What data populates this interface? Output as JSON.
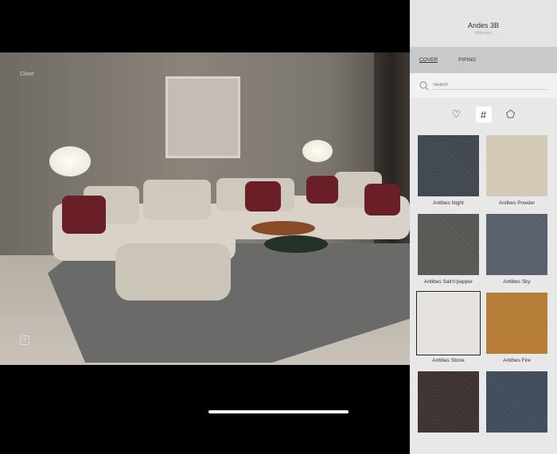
{
  "viewer": {
    "close_label": "Close"
  },
  "panel": {
    "title": "Andes 3B",
    "brand": "Wittmann",
    "tabs": [
      {
        "label": "COVER",
        "active": true
      },
      {
        "label": "PIPING",
        "active": false
      }
    ],
    "search_placeholder": "Search",
    "filters": [
      {
        "icon": "heart-icon"
      },
      {
        "icon": "fabric-icon",
        "active": true
      },
      {
        "icon": "leather-icon"
      }
    ],
    "swatches": [
      {
        "name": "Antibes Night",
        "color": "#3f454c"
      },
      {
        "name": "Antibes Powder",
        "color": "#d3c9b6"
      },
      {
        "name": "Antibes Salt'n'pepper",
        "color": "#555552"
      },
      {
        "name": "Antibes Sky",
        "color": "#565d6a"
      },
      {
        "name": "Antibes Stone",
        "color": "#e5e2dc",
        "selected": true
      },
      {
        "name": "Antibes Fire",
        "color": "#b57a33"
      },
      {
        "name": "",
        "color": "#3a3030"
      },
      {
        "name": "",
        "color": "#3e4a5a"
      }
    ]
  }
}
